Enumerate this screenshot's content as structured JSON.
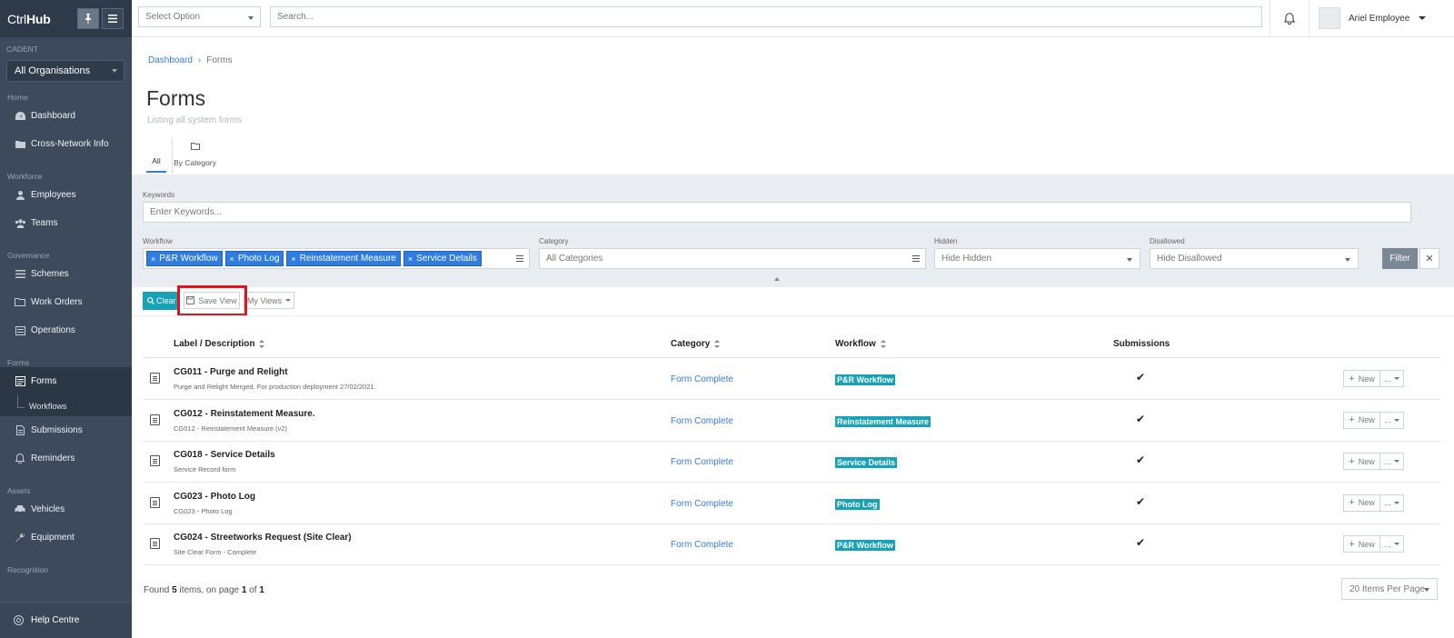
{
  "brand": {
    "prefix": "Ctrl",
    "bold": "Hub"
  },
  "sidebar": {
    "org_label": "CADENT",
    "org_select": "All Organisations",
    "sections": [
      {
        "title": "Home",
        "items": [
          "Dashboard",
          "Cross-Network Info"
        ]
      },
      {
        "title": "Workforce",
        "items": [
          "Employees",
          "Teams"
        ]
      },
      {
        "title": "Governance",
        "items": [
          "Schemes",
          "Work Orders",
          "Operations"
        ]
      },
      {
        "title": "Forms",
        "items": [
          "Forms",
          "Workflows",
          "Submissions",
          "Reminders"
        ]
      },
      {
        "title": "Assets",
        "items": [
          "Vehicles",
          "Equipment"
        ]
      },
      {
        "title": "Recognition",
        "items": []
      }
    ],
    "help": "Help Centre"
  },
  "topbar": {
    "select_placeholder": "Select Option",
    "search_placeholder": "Search...",
    "user_name": "Ariel Employee"
  },
  "breadcrumb": {
    "home": "Dashboard",
    "current": "Forms"
  },
  "page": {
    "title": "Forms",
    "subtitle": "Listing all system forms"
  },
  "tabs": {
    "all": "All",
    "by_category": "By Category"
  },
  "filters": {
    "keywords_label": "Keywords",
    "keywords_placeholder": "Enter Keywords...",
    "workflow_label": "Workflow",
    "workflow_tags": [
      "P&R Workflow",
      "Photo Log",
      "Reinstatement Measure",
      "Service Details"
    ],
    "category_label": "Category",
    "category_value": "All Categories",
    "hidden_label": "Hidden",
    "hidden_value": "Hide Hidden",
    "disallowed_label": "Disallowed",
    "disallowed_value": "Hide Disallowed",
    "filter_button": "Filter"
  },
  "toolbar": {
    "clear": "Clear",
    "save_view": "Save View",
    "my_views": "My Views"
  },
  "table": {
    "headers": {
      "label": "Label / Description",
      "category": "Category",
      "workflow": "Workflow",
      "submissions": "Submissions"
    },
    "new_label": "New",
    "more_label": "...",
    "rows": [
      {
        "label": "CG011 - Purge and Relight",
        "desc": "Purge and Relight Merged. For production deployment 27/02/2021.",
        "category": "Form Complete",
        "workflow": "P&R Workflow"
      },
      {
        "label": "CG012 - Reinstatement Measure.",
        "desc": "CG012 - Reinstatement Measure (v2)",
        "category": "Form Complete",
        "workflow": "Reinstatement Measure"
      },
      {
        "label": "CG018 - Service Details",
        "desc": "Service Record form",
        "category": "Form Complete",
        "workflow": "Service Details"
      },
      {
        "label": "CG023 - Photo Log",
        "desc": "CG023 - Photo Log",
        "category": "Form Complete",
        "workflow": "Photo Log"
      },
      {
        "label": "CG024 - Streetworks Request (Site Clear)",
        "desc": "Site Clear Form - Complete",
        "category": "Form Complete",
        "workflow": "P&R Workflow"
      }
    ]
  },
  "footer": {
    "found_prefix": "Found",
    "count": "5",
    "items_on_page": "items, on page",
    "page": "1",
    "of": "of",
    "pages": "1",
    "per_page": "20 Items Per Page"
  },
  "colors": {
    "sidebar": "#3d4a5c",
    "accent": "#17a2b8",
    "tag": "#2f7de1",
    "highlight": "#e0141e"
  }
}
